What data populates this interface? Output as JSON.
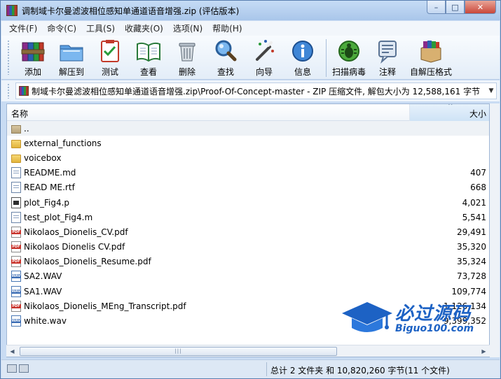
{
  "window": {
    "title": "调制域卡尔曼滤波相位感知单通道语音增强.zip (评估版本)",
    "min": "–",
    "max": "□",
    "close": "✕"
  },
  "menu": [
    "文件(F)",
    "命令(C)",
    "工具(S)",
    "收藏夹(O)",
    "选项(N)",
    "帮助(H)"
  ],
  "toolbar": {
    "add": "添加",
    "extract": "解压到",
    "test": "测试",
    "view": "查看",
    "delete": "删除",
    "find": "查找",
    "wizard": "向导",
    "info": "信息",
    "scan": "扫描病毒",
    "comment": "注释",
    "sfx": "自解压格式"
  },
  "address": {
    "path": "制域卡尔曼滤波相位感知单通道语音增强.zip\\Proof-Of-Concept-master - ZIP 压缩文件, 解包大小为 12,588,161 字节"
  },
  "columns": {
    "name": "名称",
    "size": "大小"
  },
  "files": [
    {
      "name": "..",
      "size": "",
      "type": "up"
    },
    {
      "name": "external_functions",
      "size": "",
      "type": "folder"
    },
    {
      "name": "voicebox",
      "size": "",
      "type": "folder"
    },
    {
      "name": "README.md",
      "size": "407",
      "type": "doc"
    },
    {
      "name": "READ ME.rtf",
      "size": "668",
      "type": "doc"
    },
    {
      "name": "plot_Fig4.p",
      "size": "4,021",
      "type": "p"
    },
    {
      "name": "test_plot_Fig4.m",
      "size": "5,541",
      "type": "doc"
    },
    {
      "name": "Nikolaos_Dionelis_CV.pdf",
      "size": "29,491",
      "type": "pdf"
    },
    {
      "name": "Nikolaos Dionelis CV.pdf",
      "size": "35,320",
      "type": "pdf"
    },
    {
      "name": "Nikolaos_Dionelis_Resume.pdf",
      "size": "35,324",
      "type": "pdf"
    },
    {
      "name": "SA2.WAV",
      "size": "73,728",
      "type": "wav"
    },
    {
      "name": "SA1.WAV",
      "size": "109,774",
      "type": "wav"
    },
    {
      "name": "Nikolaos_Dionelis_MEng_Transcript.pdf",
      "size": "1,126,134",
      "type": "pdf"
    },
    {
      "name": "white.wav",
      "size": "9,399,352",
      "type": "wav"
    }
  ],
  "status": {
    "summary": "总计 2 文件夹 和 10,820,260 字节(11 个文件)"
  },
  "watermark": {
    "title": "必过源码",
    "sub": "Biguo100.com"
  }
}
